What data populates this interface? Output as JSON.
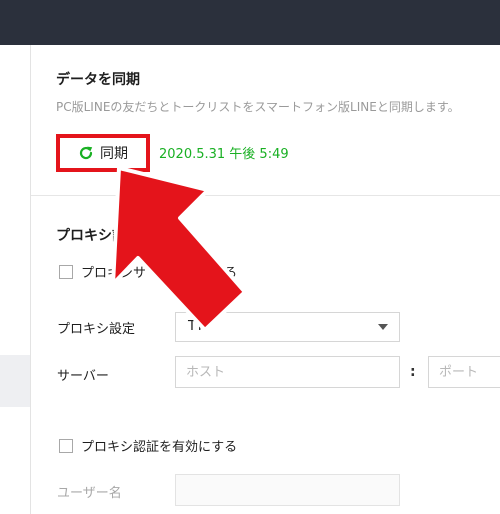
{
  "sync": {
    "title": "データを同期",
    "description": "PC版LINEの友だちとトークリストをスマートフォン版LINEと同期します。",
    "button_label": "同期",
    "button_icon": "refresh-icon",
    "last_synced": "2020.5.31 午後 5:49"
  },
  "proxy": {
    "title": "プロキシ設",
    "enable_server_label": "プロキシサ　　　効にする",
    "enable_server_checked": false,
    "setting_label": "プロキシ設定",
    "setting_value": "TTP",
    "server_label": "サーバー",
    "host_placeholder": "ホスト",
    "port_separator": ":",
    "port_placeholder": "ポート",
    "enable_auth_label": "プロキシ認証を有効にする",
    "enable_auth_checked": false,
    "username_label": "ユーザー名"
  },
  "colors": {
    "topbar": "#2b303c",
    "highlight_box": "#e4141b",
    "arrow": "#e4141b",
    "sync_time": "#19b023",
    "sync_icon": "#19b023"
  }
}
